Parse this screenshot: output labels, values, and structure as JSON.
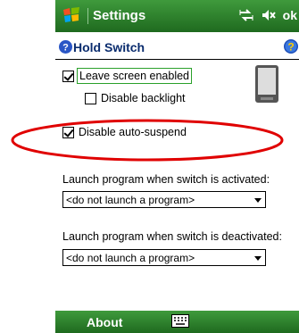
{
  "titlebar": {
    "title": "Settings",
    "ok_label": "ok"
  },
  "header": {
    "title": "Hold Switch"
  },
  "options": {
    "leave_screen_enabled": {
      "label": "Leave screen enabled",
      "checked": true
    },
    "disable_backlight": {
      "label": "Disable backlight",
      "checked": false
    },
    "disable_auto_suspend": {
      "label": "Disable auto-suspend",
      "checked": true
    }
  },
  "launch_activated": {
    "label": "Launch program when switch is activated:",
    "value": "<do not launch a program>"
  },
  "launch_deactivated": {
    "label": "Launch program when switch is deactivated:",
    "value": "<do not launch a program>"
  },
  "softbar": {
    "left_label": "About"
  },
  "colors": {
    "bar_green": "#2e8b2e",
    "highlight_red": "#e00000",
    "header_blue": "#0a2c6e"
  }
}
